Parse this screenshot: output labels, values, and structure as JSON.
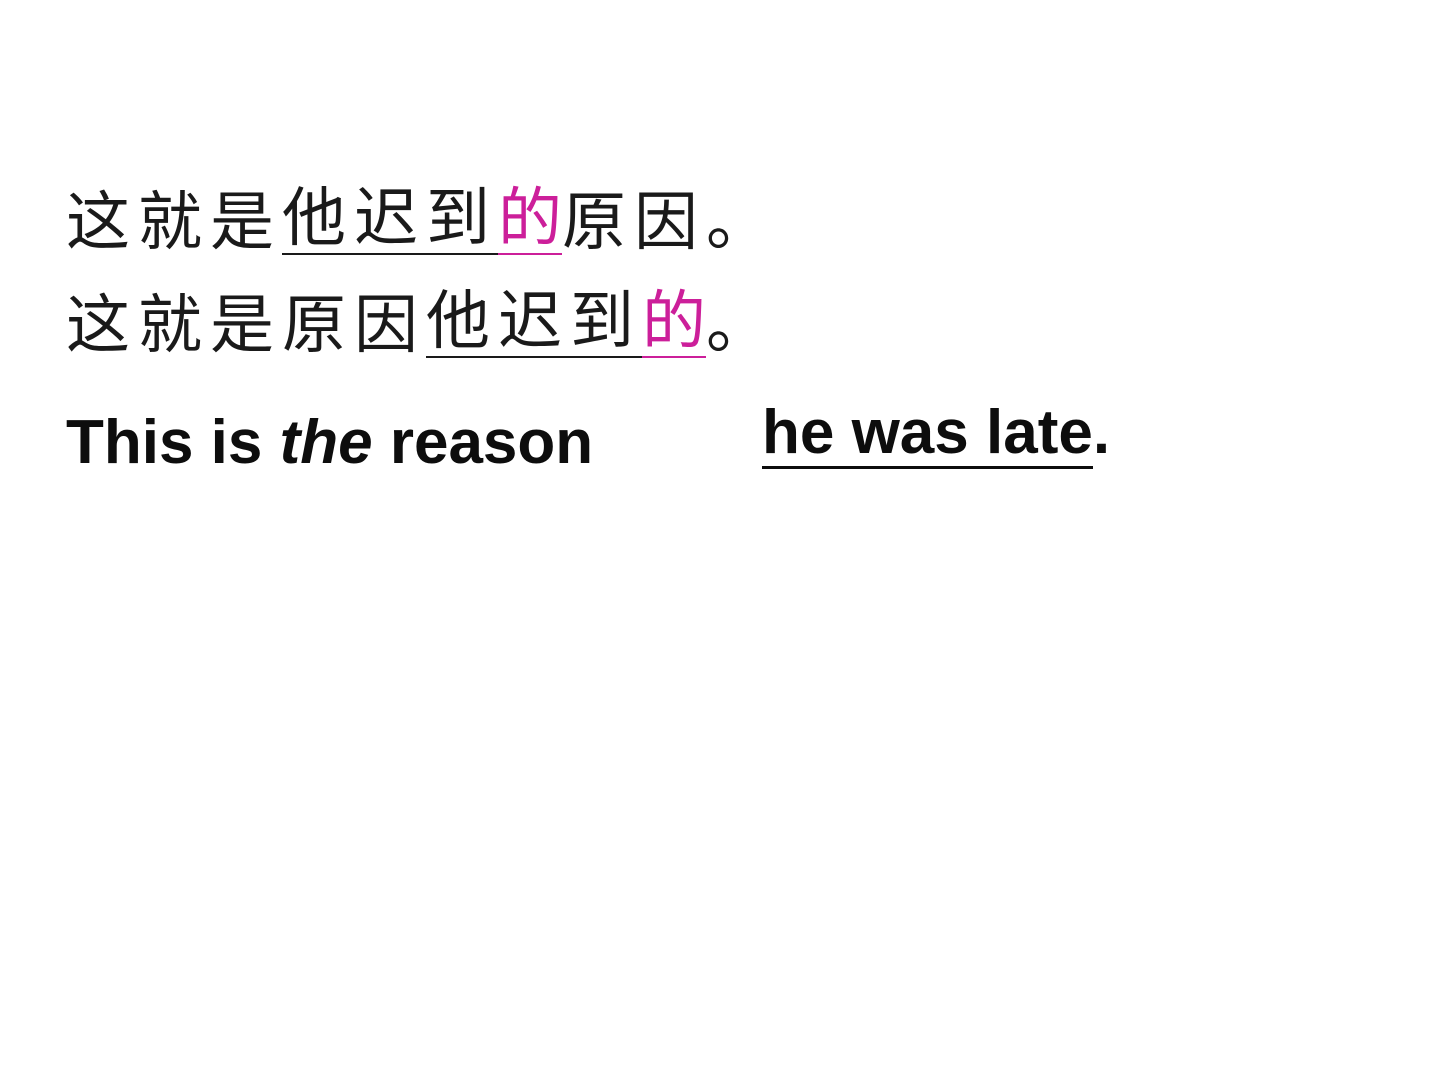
{
  "chinese": {
    "line1": {
      "lead": "这就是",
      "clause": "他迟到",
      "particle": "的",
      "tail": "原因。"
    },
    "line2": {
      "lead": "这就是原因",
      "clause": "他迟到",
      "particle": "的",
      "tail": "。"
    }
  },
  "english": {
    "left": {
      "before": "This is ",
      "emphasis": "the",
      "after": " reason"
    },
    "right": {
      "clause": "he was late",
      "punct": "."
    }
  },
  "colors": {
    "particle_accent": "#cc1f9a",
    "text": "#0d0d0d"
  }
}
